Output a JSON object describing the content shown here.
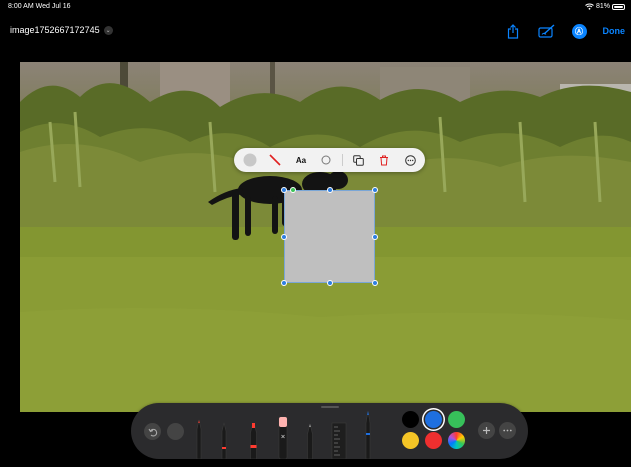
{
  "status": {
    "time_date": "8:00 AM  Wed Jul 16",
    "battery": "81%"
  },
  "header": {
    "title": "image1752667172745",
    "done_label": "Done"
  },
  "shape_toolbar": {
    "text_label": "Aa"
  },
  "colors": {
    "accent": "#0a84ff",
    "swatches": [
      "#000000",
      "#1e6fe0",
      "#37c05a",
      "#f5c526",
      "#ef2f2f",
      "multicolor"
    ]
  },
  "tools": [
    "pen",
    "monoline",
    "marker",
    "eraser",
    "pencil",
    "ruler",
    "fountain-pen"
  ],
  "icons": [
    "share-icon",
    "markup-icon",
    "undo-icon",
    "redo-icon",
    "plus-icon",
    "more-icon"
  ]
}
